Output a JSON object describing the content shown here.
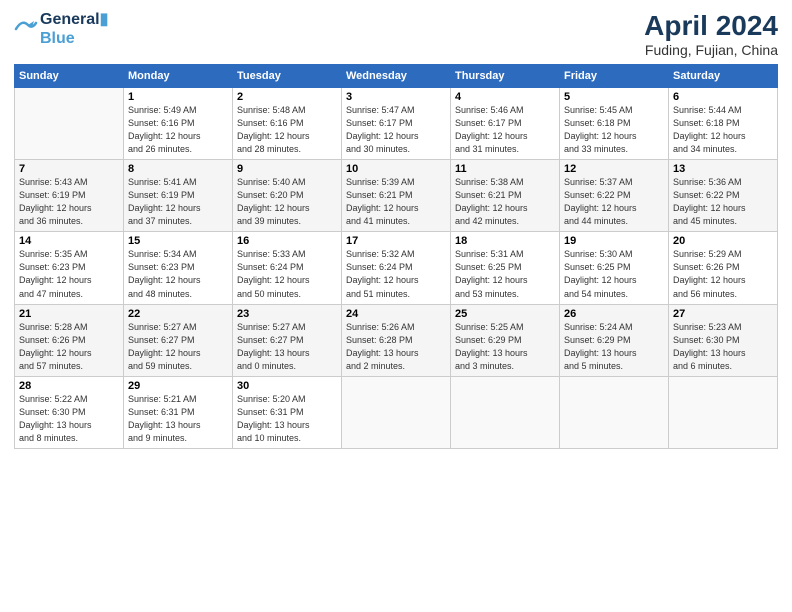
{
  "header": {
    "logo_line1": "General",
    "logo_line2": "Blue",
    "title": "April 2024",
    "subtitle": "Fuding, Fujian, China"
  },
  "days_of_week": [
    "Sunday",
    "Monday",
    "Tuesday",
    "Wednesday",
    "Thursday",
    "Friday",
    "Saturday"
  ],
  "weeks": [
    [
      {
        "day": "",
        "info": ""
      },
      {
        "day": "1",
        "info": "Sunrise: 5:49 AM\nSunset: 6:16 PM\nDaylight: 12 hours\nand 26 minutes."
      },
      {
        "day": "2",
        "info": "Sunrise: 5:48 AM\nSunset: 6:16 PM\nDaylight: 12 hours\nand 28 minutes."
      },
      {
        "day": "3",
        "info": "Sunrise: 5:47 AM\nSunset: 6:17 PM\nDaylight: 12 hours\nand 30 minutes."
      },
      {
        "day": "4",
        "info": "Sunrise: 5:46 AM\nSunset: 6:17 PM\nDaylight: 12 hours\nand 31 minutes."
      },
      {
        "day": "5",
        "info": "Sunrise: 5:45 AM\nSunset: 6:18 PM\nDaylight: 12 hours\nand 33 minutes."
      },
      {
        "day": "6",
        "info": "Sunrise: 5:44 AM\nSunset: 6:18 PM\nDaylight: 12 hours\nand 34 minutes."
      }
    ],
    [
      {
        "day": "7",
        "info": "Sunrise: 5:43 AM\nSunset: 6:19 PM\nDaylight: 12 hours\nand 36 minutes."
      },
      {
        "day": "8",
        "info": "Sunrise: 5:41 AM\nSunset: 6:19 PM\nDaylight: 12 hours\nand 37 minutes."
      },
      {
        "day": "9",
        "info": "Sunrise: 5:40 AM\nSunset: 6:20 PM\nDaylight: 12 hours\nand 39 minutes."
      },
      {
        "day": "10",
        "info": "Sunrise: 5:39 AM\nSunset: 6:21 PM\nDaylight: 12 hours\nand 41 minutes."
      },
      {
        "day": "11",
        "info": "Sunrise: 5:38 AM\nSunset: 6:21 PM\nDaylight: 12 hours\nand 42 minutes."
      },
      {
        "day": "12",
        "info": "Sunrise: 5:37 AM\nSunset: 6:22 PM\nDaylight: 12 hours\nand 44 minutes."
      },
      {
        "day": "13",
        "info": "Sunrise: 5:36 AM\nSunset: 6:22 PM\nDaylight: 12 hours\nand 45 minutes."
      }
    ],
    [
      {
        "day": "14",
        "info": "Sunrise: 5:35 AM\nSunset: 6:23 PM\nDaylight: 12 hours\nand 47 minutes."
      },
      {
        "day": "15",
        "info": "Sunrise: 5:34 AM\nSunset: 6:23 PM\nDaylight: 12 hours\nand 48 minutes."
      },
      {
        "day": "16",
        "info": "Sunrise: 5:33 AM\nSunset: 6:24 PM\nDaylight: 12 hours\nand 50 minutes."
      },
      {
        "day": "17",
        "info": "Sunrise: 5:32 AM\nSunset: 6:24 PM\nDaylight: 12 hours\nand 51 minutes."
      },
      {
        "day": "18",
        "info": "Sunrise: 5:31 AM\nSunset: 6:25 PM\nDaylight: 12 hours\nand 53 minutes."
      },
      {
        "day": "19",
        "info": "Sunrise: 5:30 AM\nSunset: 6:25 PM\nDaylight: 12 hours\nand 54 minutes."
      },
      {
        "day": "20",
        "info": "Sunrise: 5:29 AM\nSunset: 6:26 PM\nDaylight: 12 hours\nand 56 minutes."
      }
    ],
    [
      {
        "day": "21",
        "info": "Sunrise: 5:28 AM\nSunset: 6:26 PM\nDaylight: 12 hours\nand 57 minutes."
      },
      {
        "day": "22",
        "info": "Sunrise: 5:27 AM\nSunset: 6:27 PM\nDaylight: 12 hours\nand 59 minutes."
      },
      {
        "day": "23",
        "info": "Sunrise: 5:27 AM\nSunset: 6:27 PM\nDaylight: 13 hours\nand 0 minutes."
      },
      {
        "day": "24",
        "info": "Sunrise: 5:26 AM\nSunset: 6:28 PM\nDaylight: 13 hours\nand 2 minutes."
      },
      {
        "day": "25",
        "info": "Sunrise: 5:25 AM\nSunset: 6:29 PM\nDaylight: 13 hours\nand 3 minutes."
      },
      {
        "day": "26",
        "info": "Sunrise: 5:24 AM\nSunset: 6:29 PM\nDaylight: 13 hours\nand 5 minutes."
      },
      {
        "day": "27",
        "info": "Sunrise: 5:23 AM\nSunset: 6:30 PM\nDaylight: 13 hours\nand 6 minutes."
      }
    ],
    [
      {
        "day": "28",
        "info": "Sunrise: 5:22 AM\nSunset: 6:30 PM\nDaylight: 13 hours\nand 8 minutes."
      },
      {
        "day": "29",
        "info": "Sunrise: 5:21 AM\nSunset: 6:31 PM\nDaylight: 13 hours\nand 9 minutes."
      },
      {
        "day": "30",
        "info": "Sunrise: 5:20 AM\nSunset: 6:31 PM\nDaylight: 13 hours\nand 10 minutes."
      },
      {
        "day": "",
        "info": ""
      },
      {
        "day": "",
        "info": ""
      },
      {
        "day": "",
        "info": ""
      },
      {
        "day": "",
        "info": ""
      }
    ]
  ]
}
